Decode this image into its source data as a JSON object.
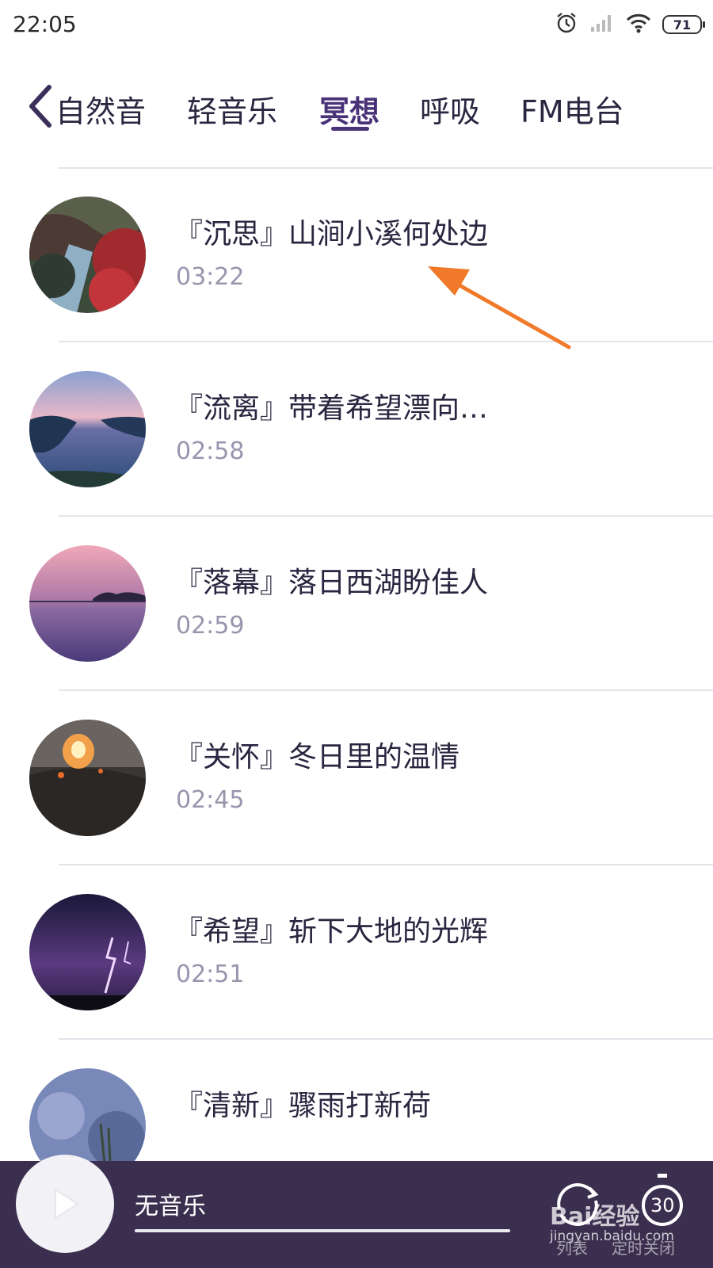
{
  "status": {
    "time": "22:05",
    "battery": "71"
  },
  "tabs": [
    "自然音",
    "轻音乐",
    "冥想",
    "呼吸",
    "FM电台"
  ],
  "active_tab": "冥想",
  "tracks": [
    {
      "title": "『沉思』山涧小溪何处边",
      "duration": "03:22"
    },
    {
      "title": "『流离』带着希望漂向…",
      "duration": "02:58"
    },
    {
      "title": "『落幕』落日西湖盼佳人",
      "duration": "02:59"
    },
    {
      "title": "『关怀』冬日里的温情",
      "duration": "02:45"
    },
    {
      "title": "『希望』斩下大地的光辉",
      "duration": "02:51"
    },
    {
      "title": "『清新』骤雨打新荷",
      "duration": ""
    }
  ],
  "player": {
    "now_playing": "无音乐",
    "list_label": "列表",
    "timer_value": "30",
    "timer_label": "定时关闭"
  },
  "watermark": {
    "brand": "Bai经验",
    "url": "jingyan.baidu.com"
  },
  "colors": {
    "accent": "#4a3279",
    "player_bg": "#3b2f4f",
    "annotation": "#f07a2a",
    "duration": "#9b94ad"
  }
}
